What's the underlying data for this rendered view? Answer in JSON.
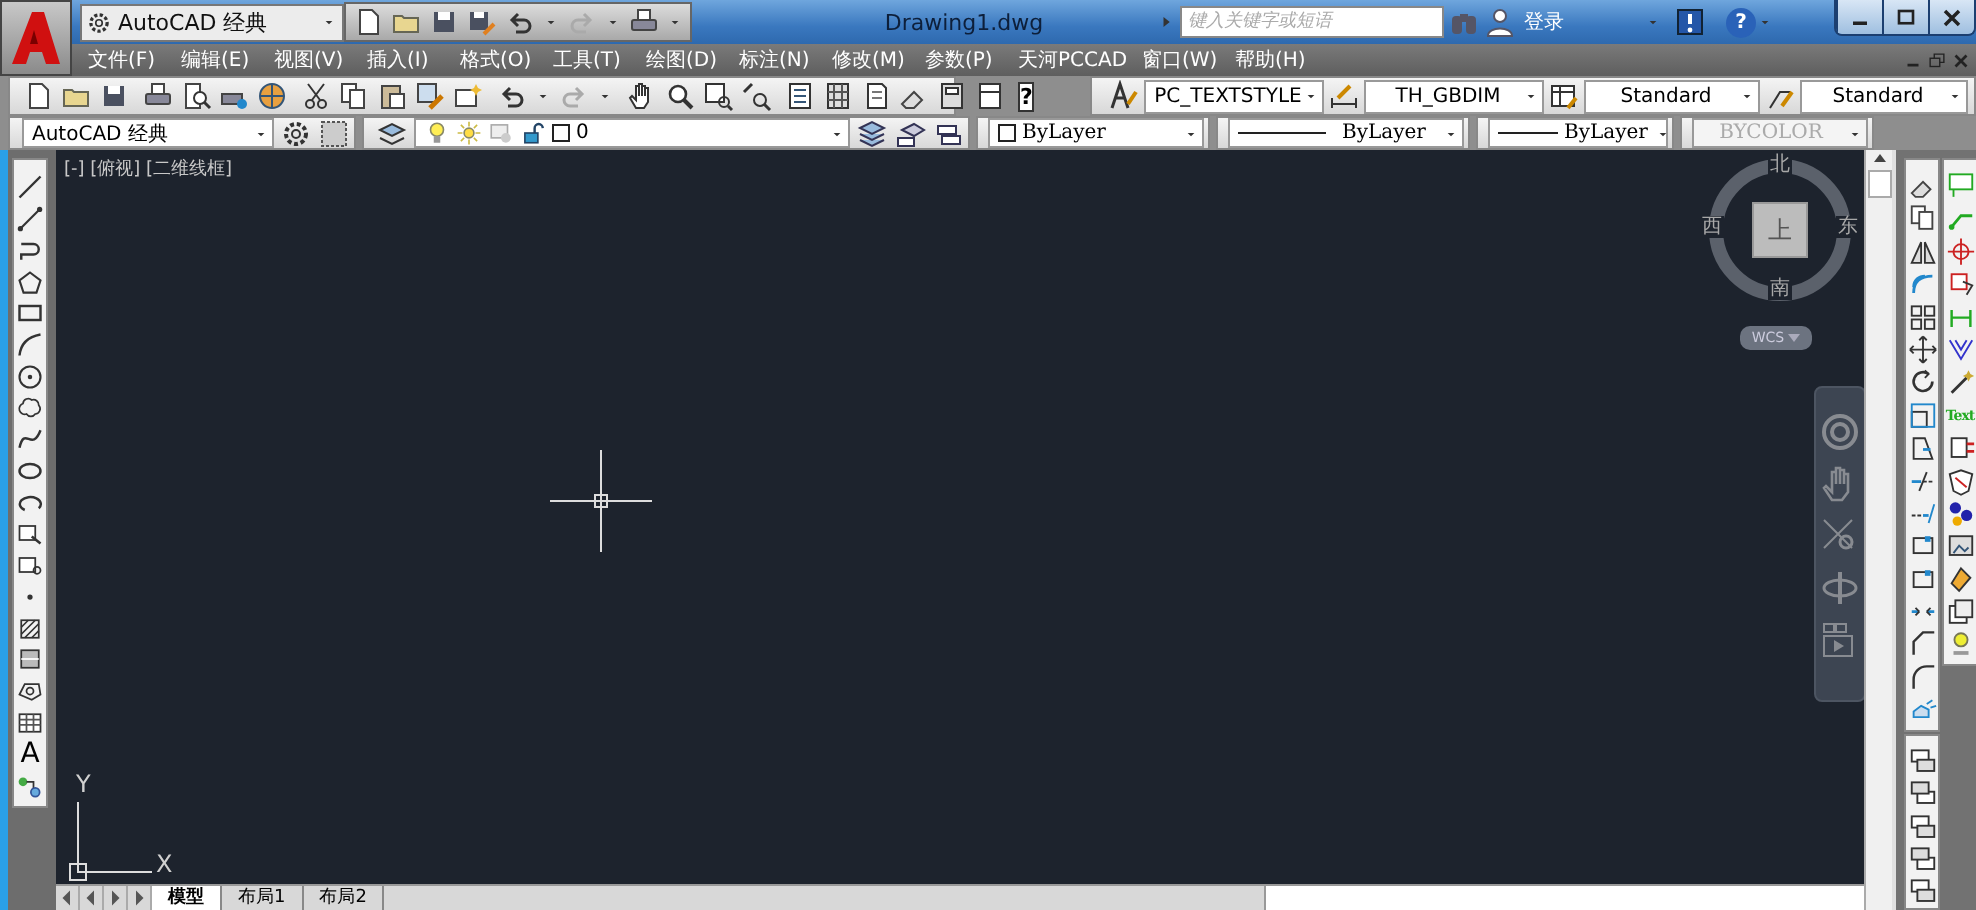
{
  "title_bar": {
    "workspace": "AutoCAD 经典",
    "title": "Drawing1.dwg",
    "search": {
      "placeholder": "键入关键字或短语"
    },
    "login": "登录",
    "help": "?"
  },
  "menu_bar": [
    {
      "label": "文件(F)"
    },
    {
      "label": "编辑(E)"
    },
    {
      "label": "视图(V)"
    },
    {
      "label": "插入(I)"
    },
    {
      "label": "格式(O)"
    },
    {
      "label": "工具(T)"
    },
    {
      "label": "绘图(D)"
    },
    {
      "label": "标注(N)"
    },
    {
      "label": "修改(M)"
    },
    {
      "label": "参数(P)"
    },
    {
      "label": "天河PCCAD"
    },
    {
      "label": "窗口(W)"
    },
    {
      "label": "帮助(H)"
    }
  ],
  "standard_toolbar": {
    "help": "?"
  },
  "styles_toolbar": [
    {
      "value": "PC_TEXTSTYLE"
    },
    {
      "value": "TH_GBDIM"
    },
    {
      "value": "Standard"
    },
    {
      "value": "Standard"
    }
  ],
  "workspace_toolbar": {
    "value": "AutoCAD 经典"
  },
  "layer_toolbar": {
    "value": "0"
  },
  "properties_toolbar": [
    {
      "kind": "color",
      "value": "ByLayer",
      "disabled": false
    },
    {
      "kind": "linetype",
      "value": "ByLayer",
      "disabled": false
    },
    {
      "kind": "lineweight",
      "value": "ByLayer",
      "disabled": false
    },
    {
      "kind": "plotstyle",
      "value": "BYCOLOR",
      "disabled": true
    }
  ],
  "draw_toolbar": {
    "text_tool": "A"
  },
  "annotation_toolbar": {
    "text_tool": "Text"
  },
  "viewport": {
    "label": "[-] [俯视] [二维线框]",
    "viewcube": {
      "top": "上",
      "north": "北",
      "south": "南",
      "east": "东",
      "west": "西"
    },
    "ucs_button": "WCS",
    "axes": {
      "x": "X",
      "y": "Y"
    }
  },
  "layout_tabs": [
    {
      "label": "模型",
      "selected": true
    },
    {
      "label": "布局1",
      "selected": false
    },
    {
      "label": "布局2",
      "selected": false
    }
  ]
}
